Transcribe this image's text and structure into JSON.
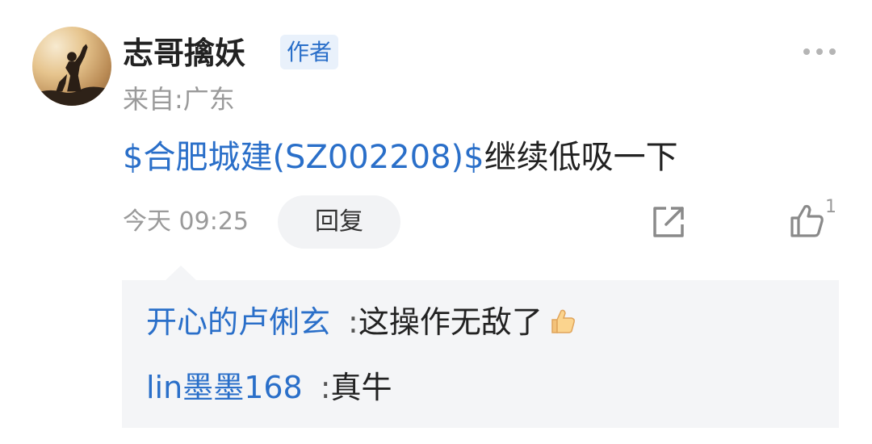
{
  "post": {
    "author": {
      "name": "志哥擒妖",
      "badge": "作者",
      "location": "来自:广东"
    },
    "content": {
      "stock_tag": "$合肥城建(SZ002208)$",
      "text": "继续低吸一下"
    },
    "timestamp": "今天 09:25",
    "actions": {
      "reply_label": "回复",
      "like_count": "1"
    },
    "icons": {
      "more": "more-dots-icon",
      "share": "share-icon",
      "like": "thumbs-up-icon"
    }
  },
  "replies": [
    {
      "user": "开心的卢俐玄",
      "separator": ":",
      "text": "这操作无敌了",
      "emoji": "thumbs-up-emoji"
    },
    {
      "user": "lin墨墨168",
      "separator": ":",
      "text": "真牛"
    }
  ],
  "colors": {
    "link": "#2a6fc9",
    "badge_bg": "#e9f1fb",
    "muted": "#9a9a9a",
    "reply_bg": "#f4f5f7"
  }
}
